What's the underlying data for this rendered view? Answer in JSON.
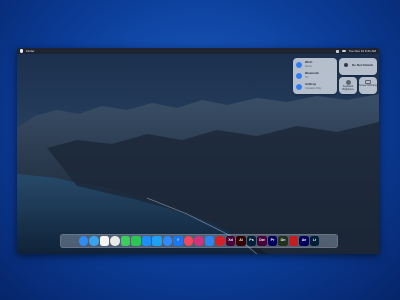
{
  "menubar": {
    "app_name": "Finder",
    "clock": "Tue Nov 10 9:41 AM"
  },
  "control_center": {
    "wifi": {
      "title": "Wi-Fi",
      "subtitle": "Home"
    },
    "bluetooth": {
      "title": "Bluetooth",
      "subtitle": "On"
    },
    "airdrop": {
      "title": "AirDrop",
      "subtitle": "Contacts Only"
    },
    "do_not_disturb": {
      "title": "Do Not Disturb"
    },
    "keyboard_brightness": {
      "label": "Keyboard Brightness"
    },
    "screen_mirroring": {
      "label": "Screen Mirroring"
    }
  },
  "dock": {
    "apps": [
      {
        "name": "Finder",
        "icon": "finder-icon",
        "color": "#2f8cf2",
        "glyph": ""
      },
      {
        "name": "Safari",
        "icon": "safari-icon",
        "color": "#3aa3f0",
        "glyph": ""
      },
      {
        "name": "Calendar",
        "icon": "calendar-icon",
        "color": "#f4f4f4",
        "glyph": ""
      },
      {
        "name": "Chrome",
        "icon": "chrome-icon",
        "color": "#e9e9e9",
        "glyph": ""
      },
      {
        "name": "Messages",
        "icon": "messages-icon",
        "color": "#3ccd5b",
        "glyph": ""
      },
      {
        "name": "FaceTime",
        "icon": "facetime-icon",
        "color": "#2bc653",
        "glyph": ""
      },
      {
        "name": "App Store",
        "icon": "app-store-icon",
        "color": "#1f8df5",
        "glyph": ""
      },
      {
        "name": "Twitter",
        "icon": "twitter-icon",
        "color": "#1da1f2",
        "glyph": ""
      },
      {
        "name": "Messenger",
        "icon": "messenger-icon",
        "color": "#2d8cff",
        "glyph": ""
      },
      {
        "name": "Facebook",
        "icon": "facebook-icon",
        "color": "#1877f2",
        "glyph": "f"
      },
      {
        "name": "Music",
        "icon": "music-icon",
        "color": "#f5475f",
        "glyph": ""
      },
      {
        "name": "Instagram",
        "icon": "instagram-icon",
        "color": "#d3327c",
        "glyph": ""
      },
      {
        "name": "Mail",
        "icon": "mail-icon",
        "color": "#2a86f0",
        "glyph": ""
      },
      {
        "name": "Creative Cloud",
        "icon": "creative-cloud-icon",
        "color": "#da1f26",
        "glyph": ""
      },
      {
        "name": "Adobe XD",
        "icon": "adobe-xd-icon",
        "color": "#470137",
        "glyph": "Xd"
      },
      {
        "name": "Illustrator",
        "icon": "illustrator-icon",
        "color": "#330000",
        "glyph": "Ai"
      },
      {
        "name": "Photoshop",
        "icon": "photoshop-icon",
        "color": "#001e36",
        "glyph": "Ps"
      },
      {
        "name": "Dreamweaver",
        "icon": "dreamweaver-icon",
        "color": "#470137",
        "glyph": "Dw"
      },
      {
        "name": "Premiere Pro",
        "icon": "premiere-icon",
        "color": "#00005b",
        "glyph": "Pr"
      },
      {
        "name": "Dimension",
        "icon": "dimension-icon",
        "color": "#23311d",
        "glyph": "Dn"
      },
      {
        "name": "Acrobat",
        "icon": "acrobat-icon",
        "color": "#c41e1e",
        "glyph": ""
      },
      {
        "name": "After Effects",
        "icon": "after-effects-icon",
        "color": "#00005b",
        "glyph": "Ae"
      },
      {
        "name": "Lightroom",
        "icon": "lightroom-icon",
        "color": "#001e36",
        "glyph": "Lr"
      }
    ]
  }
}
